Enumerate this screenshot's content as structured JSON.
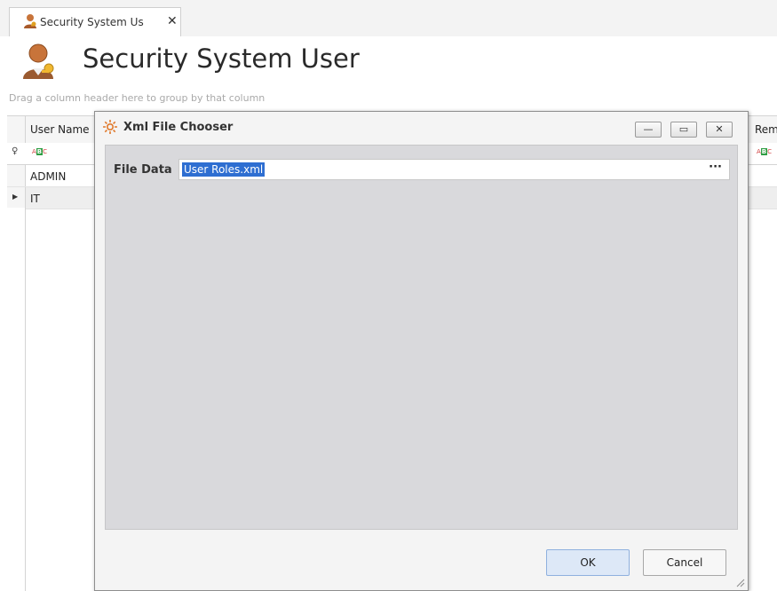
{
  "tab": {
    "label": "Security System Us",
    "close_glyph": "✕",
    "icon": "user-key-icon"
  },
  "header": {
    "title": "Security System User",
    "icon": "user-key-icon"
  },
  "group_panel_text": "Drag a column header here to group by that column",
  "grid": {
    "columns": [
      "User Name",
      "Rem"
    ],
    "rows": [
      {
        "user_name": "ADMIN",
        "selected": false
      },
      {
        "user_name": "IT",
        "selected": true
      }
    ],
    "filter_icon": "abc-filter-icon",
    "pin_glyph": "♀"
  },
  "dialog": {
    "title": "Xml File Chooser",
    "title_icon": "orange-gear-icon",
    "buttons": {
      "minimize": "—",
      "maximize": "▭",
      "close": "✕"
    },
    "field_label": "File Data",
    "field_value": "User Roles.xml",
    "ellipsis": "···",
    "ok_label": "OK",
    "cancel_label": "Cancel"
  },
  "colors": {
    "selection": "#2e6ed1",
    "content_bg": "#d9d9dc",
    "ok_button": "#dde8f7"
  }
}
